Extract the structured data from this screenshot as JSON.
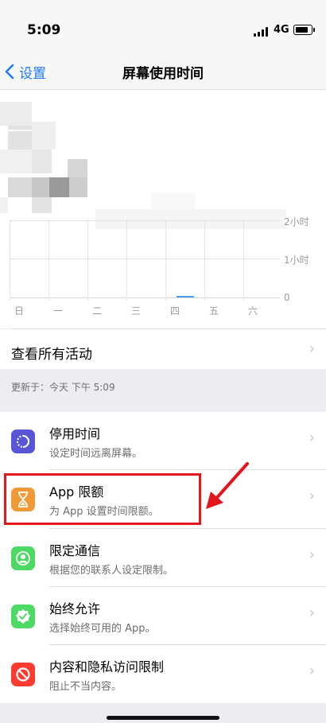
{
  "status": {
    "time": "5:09",
    "network": "4G"
  },
  "nav": {
    "back_label": "设置",
    "title": "屏幕使用时间"
  },
  "chart_data": {
    "type": "bar",
    "categories": [
      "日",
      "一",
      "二",
      "三",
      "四",
      "五",
      "六"
    ],
    "y_ticks": [
      "2小时",
      "1小时",
      "0"
    ],
    "grid": true
  },
  "links": {
    "see_all": "查看所有活动"
  },
  "updated_text": "更新于：今天 下午 5:09",
  "features": [
    {
      "title": "停用时间",
      "subtitle": "设定时间远离屏幕。",
      "color": "#5856d6",
      "icon": "downtime-icon"
    },
    {
      "title": "App 限额",
      "subtitle": "为 App 设置时间限额。",
      "color": "#f09a37",
      "icon": "hourglass-icon"
    },
    {
      "title": "限定通信",
      "subtitle": "根据您的联系人设定限制。",
      "color": "#4cd964",
      "icon": "person-circle-icon"
    },
    {
      "title": "始终允许",
      "subtitle": "选择始终可用的 App。",
      "color": "#4cd964",
      "icon": "checkmark-badge-icon"
    },
    {
      "title": "内容和隐私访问限制",
      "subtitle": "阻止不当内容。",
      "color": "#ff3b30",
      "icon": "no-entry-icon"
    }
  ],
  "highlight_color": "#e3171b"
}
